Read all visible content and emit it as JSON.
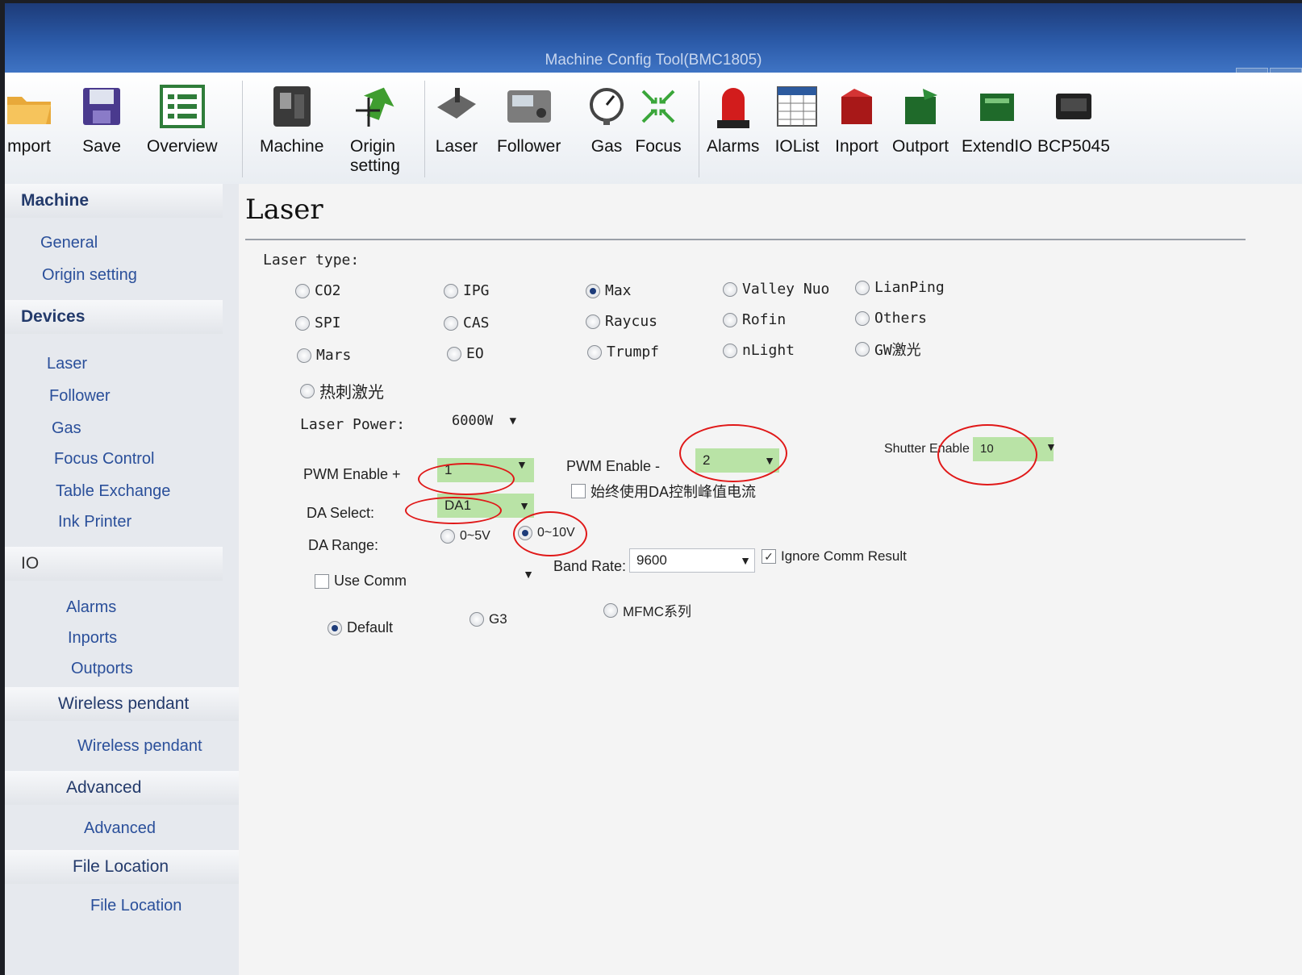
{
  "window": {
    "title": "Machine Config Tool(BMC1805)",
    "min": "–",
    "max": "□"
  },
  "toolbar": {
    "import": "mport",
    "save": "Save",
    "overview": "Overview",
    "machine": "Machine",
    "origin": "Origin",
    "origin2": "setting",
    "laser": "Laser",
    "follower": "Follower",
    "gas": "Gas",
    "focus": "Focus",
    "alarms": "Alarms",
    "iolist": "IOList",
    "inport": "Inport",
    "outport": "Outport",
    "extendio": "ExtendIO",
    "bcp": "BCP5045"
  },
  "sidebar": {
    "machine": "Machine",
    "general": "General",
    "origin": "Origin setting",
    "devices": "Devices",
    "laser": "Laser",
    "follower": "Follower",
    "gas": "Gas",
    "focus": "Focus Control",
    "table": "Table Exchange",
    "ink": "Ink Printer",
    "io": "IO",
    "alarms": "Alarms",
    "inports": "Inports",
    "outports": "Outports",
    "wireless_head": "Wireless pendant",
    "wireless": "Wireless pendant",
    "advanced_head": "Advanced",
    "advanced": "Advanced",
    "file_head": "File Location",
    "file": "File Location"
  },
  "laser": {
    "title": "Laser",
    "type_label": "Laser type:",
    "types": [
      "CO2",
      "IPG",
      "Max",
      "Valley Nuo",
      "LianPing",
      "SPI",
      "CAS",
      "Raycus",
      "Rofin",
      "Others",
      "Mars",
      "EO",
      "Trumpf",
      "nLight",
      "GW激光",
      "热刺激光"
    ],
    "selected_type": "Max",
    "power_label": "Laser Power:",
    "power_value": "6000W",
    "pwm_plus_label": "PWM Enable +",
    "pwm_plus_value": "1",
    "pwm_minus_label": "PWM Enable -",
    "pwm_minus_value": "2",
    "shutter_label": "Shutter Enable",
    "shutter_value": "10",
    "always_da": "始终使用DA控制峰值电流",
    "da_select_label": "DA Select:",
    "da_select_value": "DA1",
    "da_range_label": "DA Range:",
    "da_5v": "0~5V",
    "da_10v": "0~10V",
    "use_comm": "Use Comm",
    "band_label": "Band Rate:",
    "band_value": "9600",
    "ignore": "Ignore Comm Result",
    "ignore_check": "✓",
    "opt_default": "Default",
    "opt_g3": "G3",
    "opt_mfmc": "MFMC系列"
  },
  "colors": {
    "highlight": "#b9e3a6",
    "annotation": "#e01818",
    "titlebar": "#2b5aa8"
  },
  "icons": [
    "folder-icon",
    "save-icon",
    "overview-icon",
    "machine-icon",
    "origin-arrow-icon",
    "laser-icon",
    "follower-icon",
    "gas-gauge-icon",
    "focus-icon",
    "alarm-light-icon",
    "iolist-icon",
    "inport-icon",
    "outport-icon",
    "extendio-icon",
    "bcp-icon"
  ]
}
